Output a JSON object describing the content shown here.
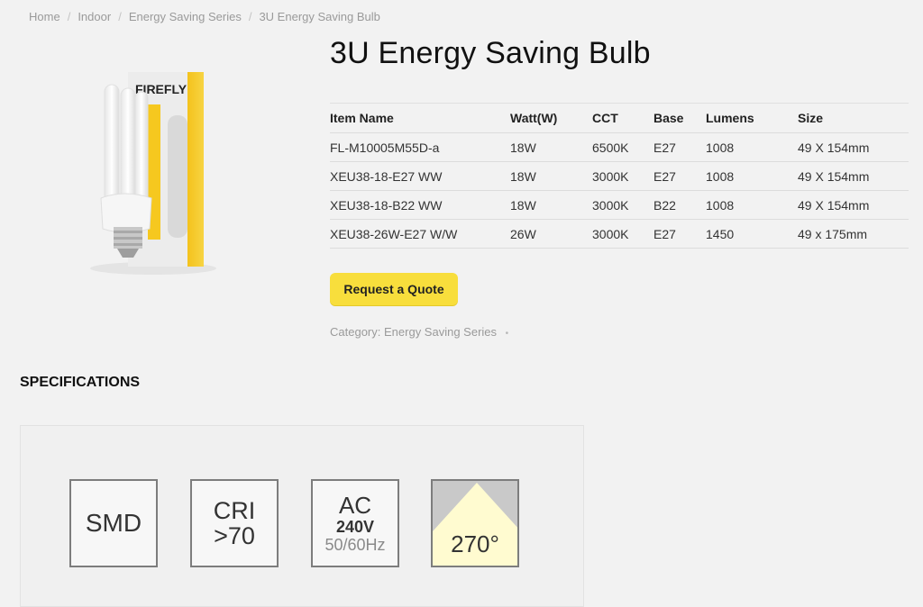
{
  "breadcrumb": [
    {
      "label": "Home"
    },
    {
      "label": "Indoor"
    },
    {
      "label": "Energy Saving Series"
    },
    {
      "label": "3U Energy Saving Bulb"
    }
  ],
  "product": {
    "title": "3U Energy Saving Bulb",
    "image_brand": "FIREFLY"
  },
  "table": {
    "headers": [
      "Item Name",
      "Watt(W)",
      "CCT",
      "Base",
      "Lumens",
      "Size"
    ],
    "rows": [
      [
        "FL-M10005M55D-a",
        "18W",
        "6500K",
        "E27",
        "1008",
        "49 X 154mm"
      ],
      [
        "XEU38-18-E27 WW",
        "18W",
        "3000K",
        "E27",
        "1008",
        "49 X 154mm"
      ],
      [
        "XEU38-18-B22 WW",
        "18W",
        "3000K",
        "B22",
        "1008",
        "49 X 154mm"
      ],
      [
        "XEU38-26W-E27 W/W",
        "26W",
        "3000K",
        "E27",
        "1450",
        "49 x 175mm"
      ]
    ]
  },
  "actions": {
    "quote_label": "Request a Quote"
  },
  "category": {
    "prefix": "Category:",
    "link": "Energy Saving Series",
    "suffix": "•"
  },
  "specifications": {
    "heading": "SPECIFICATIONS",
    "smd": "SMD",
    "cri_line1": "CRI",
    "cri_line2": ">70",
    "ac_line1": "AC",
    "ac_line2": "240V",
    "ac_line3": "50/60Hz",
    "beam": "270°"
  },
  "colors": {
    "background": "#f2f2f2",
    "accent": "#f8de3c",
    "beam_light": "#fffbd0"
  }
}
